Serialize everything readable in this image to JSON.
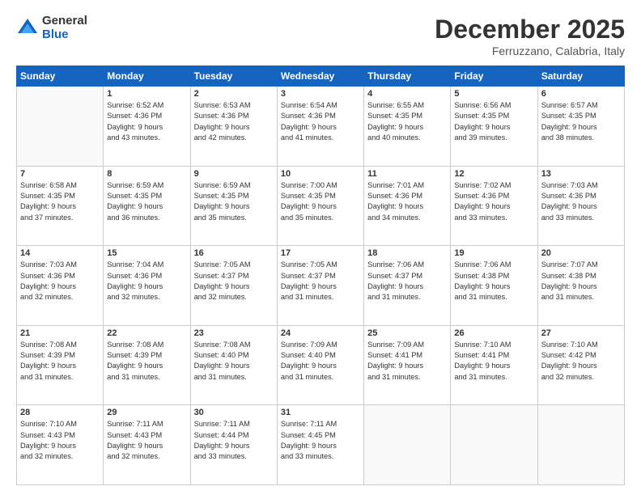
{
  "logo": {
    "general": "General",
    "blue": "Blue"
  },
  "title": "December 2025",
  "location": "Ferruzzano, Calabria, Italy",
  "days_header": [
    "Sunday",
    "Monday",
    "Tuesday",
    "Wednesday",
    "Thursday",
    "Friday",
    "Saturday"
  ],
  "weeks": [
    [
      {
        "day": "",
        "info": ""
      },
      {
        "day": "1",
        "info": "Sunrise: 6:52 AM\nSunset: 4:36 PM\nDaylight: 9 hours\nand 43 minutes."
      },
      {
        "day": "2",
        "info": "Sunrise: 6:53 AM\nSunset: 4:36 PM\nDaylight: 9 hours\nand 42 minutes."
      },
      {
        "day": "3",
        "info": "Sunrise: 6:54 AM\nSunset: 4:36 PM\nDaylight: 9 hours\nand 41 minutes."
      },
      {
        "day": "4",
        "info": "Sunrise: 6:55 AM\nSunset: 4:35 PM\nDaylight: 9 hours\nand 40 minutes."
      },
      {
        "day": "5",
        "info": "Sunrise: 6:56 AM\nSunset: 4:35 PM\nDaylight: 9 hours\nand 39 minutes."
      },
      {
        "day": "6",
        "info": "Sunrise: 6:57 AM\nSunset: 4:35 PM\nDaylight: 9 hours\nand 38 minutes."
      }
    ],
    [
      {
        "day": "7",
        "info": "Sunrise: 6:58 AM\nSunset: 4:35 PM\nDaylight: 9 hours\nand 37 minutes."
      },
      {
        "day": "8",
        "info": "Sunrise: 6:59 AM\nSunset: 4:35 PM\nDaylight: 9 hours\nand 36 minutes."
      },
      {
        "day": "9",
        "info": "Sunrise: 6:59 AM\nSunset: 4:35 PM\nDaylight: 9 hours\nand 35 minutes."
      },
      {
        "day": "10",
        "info": "Sunrise: 7:00 AM\nSunset: 4:35 PM\nDaylight: 9 hours\nand 35 minutes."
      },
      {
        "day": "11",
        "info": "Sunrise: 7:01 AM\nSunset: 4:36 PM\nDaylight: 9 hours\nand 34 minutes."
      },
      {
        "day": "12",
        "info": "Sunrise: 7:02 AM\nSunset: 4:36 PM\nDaylight: 9 hours\nand 33 minutes."
      },
      {
        "day": "13",
        "info": "Sunrise: 7:03 AM\nSunset: 4:36 PM\nDaylight: 9 hours\nand 33 minutes."
      }
    ],
    [
      {
        "day": "14",
        "info": "Sunrise: 7:03 AM\nSunset: 4:36 PM\nDaylight: 9 hours\nand 32 minutes."
      },
      {
        "day": "15",
        "info": "Sunrise: 7:04 AM\nSunset: 4:36 PM\nDaylight: 9 hours\nand 32 minutes."
      },
      {
        "day": "16",
        "info": "Sunrise: 7:05 AM\nSunset: 4:37 PM\nDaylight: 9 hours\nand 32 minutes."
      },
      {
        "day": "17",
        "info": "Sunrise: 7:05 AM\nSunset: 4:37 PM\nDaylight: 9 hours\nand 31 minutes."
      },
      {
        "day": "18",
        "info": "Sunrise: 7:06 AM\nSunset: 4:37 PM\nDaylight: 9 hours\nand 31 minutes."
      },
      {
        "day": "19",
        "info": "Sunrise: 7:06 AM\nSunset: 4:38 PM\nDaylight: 9 hours\nand 31 minutes."
      },
      {
        "day": "20",
        "info": "Sunrise: 7:07 AM\nSunset: 4:38 PM\nDaylight: 9 hours\nand 31 minutes."
      }
    ],
    [
      {
        "day": "21",
        "info": "Sunrise: 7:08 AM\nSunset: 4:39 PM\nDaylight: 9 hours\nand 31 minutes."
      },
      {
        "day": "22",
        "info": "Sunrise: 7:08 AM\nSunset: 4:39 PM\nDaylight: 9 hours\nand 31 minutes."
      },
      {
        "day": "23",
        "info": "Sunrise: 7:08 AM\nSunset: 4:40 PM\nDaylight: 9 hours\nand 31 minutes."
      },
      {
        "day": "24",
        "info": "Sunrise: 7:09 AM\nSunset: 4:40 PM\nDaylight: 9 hours\nand 31 minutes."
      },
      {
        "day": "25",
        "info": "Sunrise: 7:09 AM\nSunset: 4:41 PM\nDaylight: 9 hours\nand 31 minutes."
      },
      {
        "day": "26",
        "info": "Sunrise: 7:10 AM\nSunset: 4:41 PM\nDaylight: 9 hours\nand 31 minutes."
      },
      {
        "day": "27",
        "info": "Sunrise: 7:10 AM\nSunset: 4:42 PM\nDaylight: 9 hours\nand 32 minutes."
      }
    ],
    [
      {
        "day": "28",
        "info": "Sunrise: 7:10 AM\nSunset: 4:43 PM\nDaylight: 9 hours\nand 32 minutes."
      },
      {
        "day": "29",
        "info": "Sunrise: 7:11 AM\nSunset: 4:43 PM\nDaylight: 9 hours\nand 32 minutes."
      },
      {
        "day": "30",
        "info": "Sunrise: 7:11 AM\nSunset: 4:44 PM\nDaylight: 9 hours\nand 33 minutes."
      },
      {
        "day": "31",
        "info": "Sunrise: 7:11 AM\nSunset: 4:45 PM\nDaylight: 9 hours\nand 33 minutes."
      },
      {
        "day": "",
        "info": ""
      },
      {
        "day": "",
        "info": ""
      },
      {
        "day": "",
        "info": ""
      }
    ]
  ]
}
